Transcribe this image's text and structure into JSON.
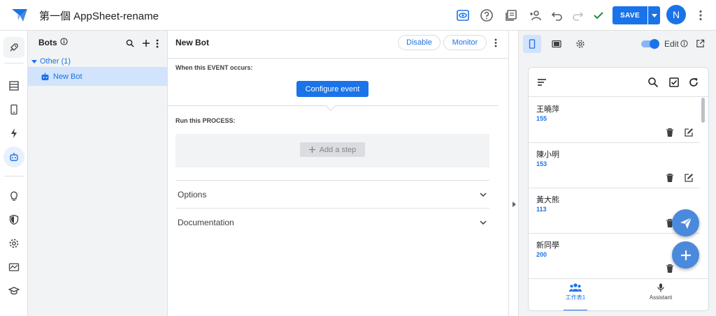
{
  "app": {
    "title": "第一個 AppSheet-rename",
    "save_label": "SAVE",
    "avatar_initial": "N",
    "accent_color": "#1a73e8",
    "icons": [
      "appsheet-logo-icon",
      "preview-eye-icon",
      "help-icon",
      "gallery-icon",
      "share-user-icon",
      "undo-icon",
      "redo-icon",
      "check-icon",
      "caret-down-icon",
      "more-vert-icon"
    ]
  },
  "rail": {
    "items": [
      "deploy-icon",
      "data-table-icon",
      "app-screen-icon",
      "automation-bolt-icon",
      "bot-icon",
      "lightbulb-icon",
      "security-shield-icon",
      "settings-gear-icon",
      "monitor-icon",
      "learn-cap-icon"
    ]
  },
  "bots": {
    "header": "Bots",
    "group_label": "Other (1)",
    "items": [
      {
        "label": "New Bot",
        "selected": true
      }
    ]
  },
  "editor": {
    "title": "New Bot",
    "disable_label": "Disable",
    "monitor_label": "Monitor",
    "event_label": "When this EVENT occurs:",
    "configure_label": "Configure event",
    "process_label": "Run this PROCESS:",
    "add_step_label": "Add a step",
    "sections": [
      {
        "label": "Options"
      },
      {
        "label": "Documentation"
      }
    ]
  },
  "preview": {
    "edit_label": "Edit",
    "edit_enabled": true,
    "contacts": [
      {
        "name": "王曉萍",
        "number": "155"
      },
      {
        "name": "陳小明",
        "number": "153"
      },
      {
        "name": "黃大熊",
        "number": "113"
      },
      {
        "name": "新同學",
        "number": "200"
      }
    ],
    "nav": [
      {
        "label": "工作表1",
        "active": true
      },
      {
        "label": "Assistant",
        "active": false
      }
    ]
  }
}
